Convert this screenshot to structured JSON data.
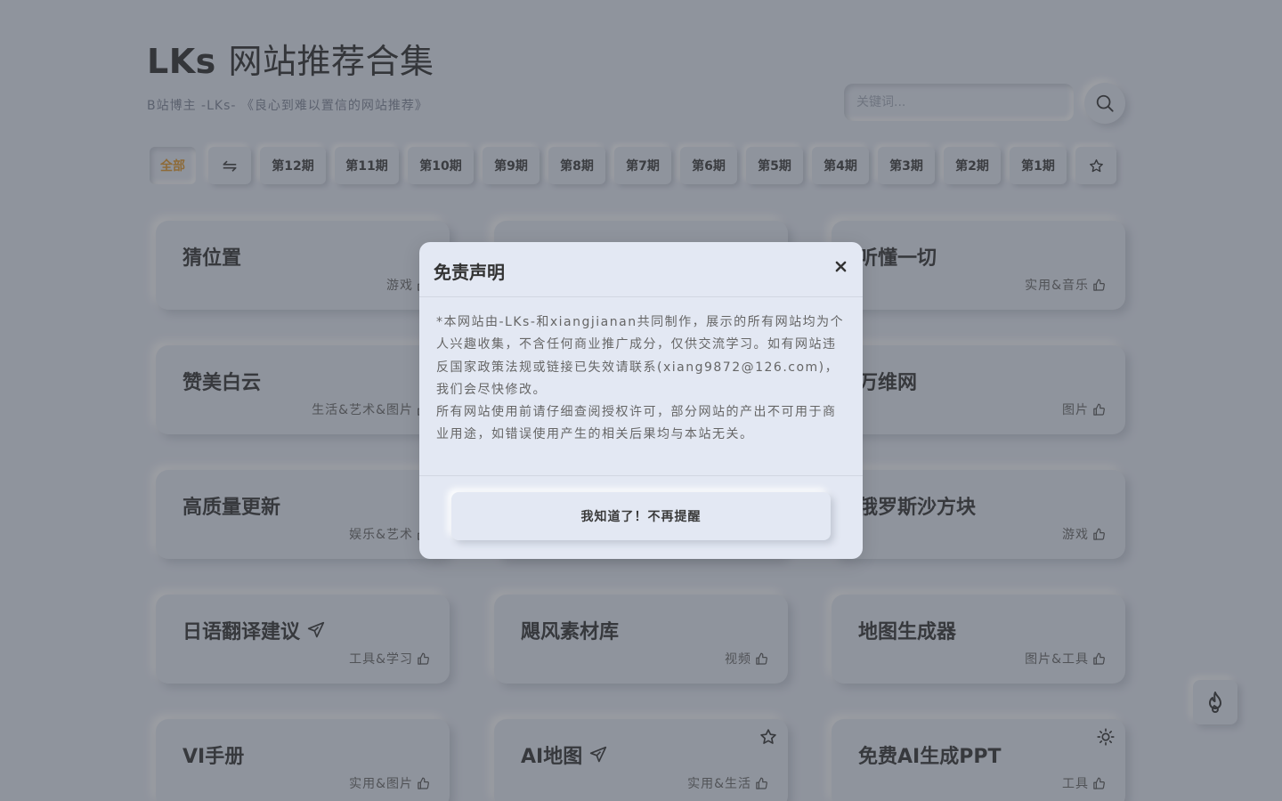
{
  "header": {
    "title_latin": "LKs",
    "title_cn": "网站推荐合集",
    "subtitle": "B站博主 -LKs- 《良心到难以置信的网站推荐》"
  },
  "search": {
    "placeholder": "关键词...",
    "icon": "search-icon"
  },
  "tabs": [
    {
      "label": "全部",
      "active": true
    },
    {
      "label": "⇋",
      "icon": "shuffle-icon"
    },
    {
      "label": "第12期"
    },
    {
      "label": "第11期"
    },
    {
      "label": "第10期"
    },
    {
      "label": "第9期"
    },
    {
      "label": "第8期"
    },
    {
      "label": "第7期"
    },
    {
      "label": "第6期"
    },
    {
      "label": "第5期"
    },
    {
      "label": "第4期"
    },
    {
      "label": "第3期"
    },
    {
      "label": "第2期"
    },
    {
      "label": "第1期"
    },
    {
      "label": "",
      "icon": "star-icon"
    }
  ],
  "cards": [
    {
      "title": "猜位置",
      "tags": "游戏"
    },
    {
      "title": "",
      "tags": ""
    },
    {
      "title": "听懂一切",
      "tags": "实用&音乐"
    },
    {
      "title": "赞美白云",
      "tags": "生活&艺术&图片"
    },
    {
      "title": "",
      "tags": ""
    },
    {
      "title": "万维网",
      "tags": "图片"
    },
    {
      "title": "高质量更新",
      "tags": "娱乐&艺术"
    },
    {
      "title": "",
      "tags": ""
    },
    {
      "title": "俄罗斯沙方块",
      "tags": "游戏"
    },
    {
      "title": "日语翻译建议",
      "tags": "工具&学习",
      "title_icon": "send-icon"
    },
    {
      "title": "飓风素材库",
      "tags": "视频"
    },
    {
      "title": "地图生成器",
      "tags": "图片&工具"
    },
    {
      "title": "VI手册",
      "tags": "实用&图片"
    },
    {
      "title": "AI地图",
      "tags": "实用&生活",
      "title_icon": "send-icon",
      "corner_icon": "star-icon"
    },
    {
      "title": "免费AI生成PPT",
      "tags": "工具",
      "corner_icon": "sun-icon"
    }
  ],
  "fab": {
    "icon": "fire-icon"
  },
  "modal": {
    "title": "免责声明",
    "close_icon": "close-icon",
    "paragraph1": "*本网站由-LKs-和xiangjianan共同制作，展示的所有网站均为个人兴趣收集，不含任何商业推广成分，仅供交流学习。如有网站违反国家政策法规或链接已失效请联系(xiang9872@126.com)，我们会尽快修改。",
    "paragraph2": "所有网站使用前请仔细查阅授权许可，部分网站的产出不可用于商业用途，如错误使用产生的相关后果均与本站无关。",
    "confirm_label": "我知道了！不再提醒"
  }
}
